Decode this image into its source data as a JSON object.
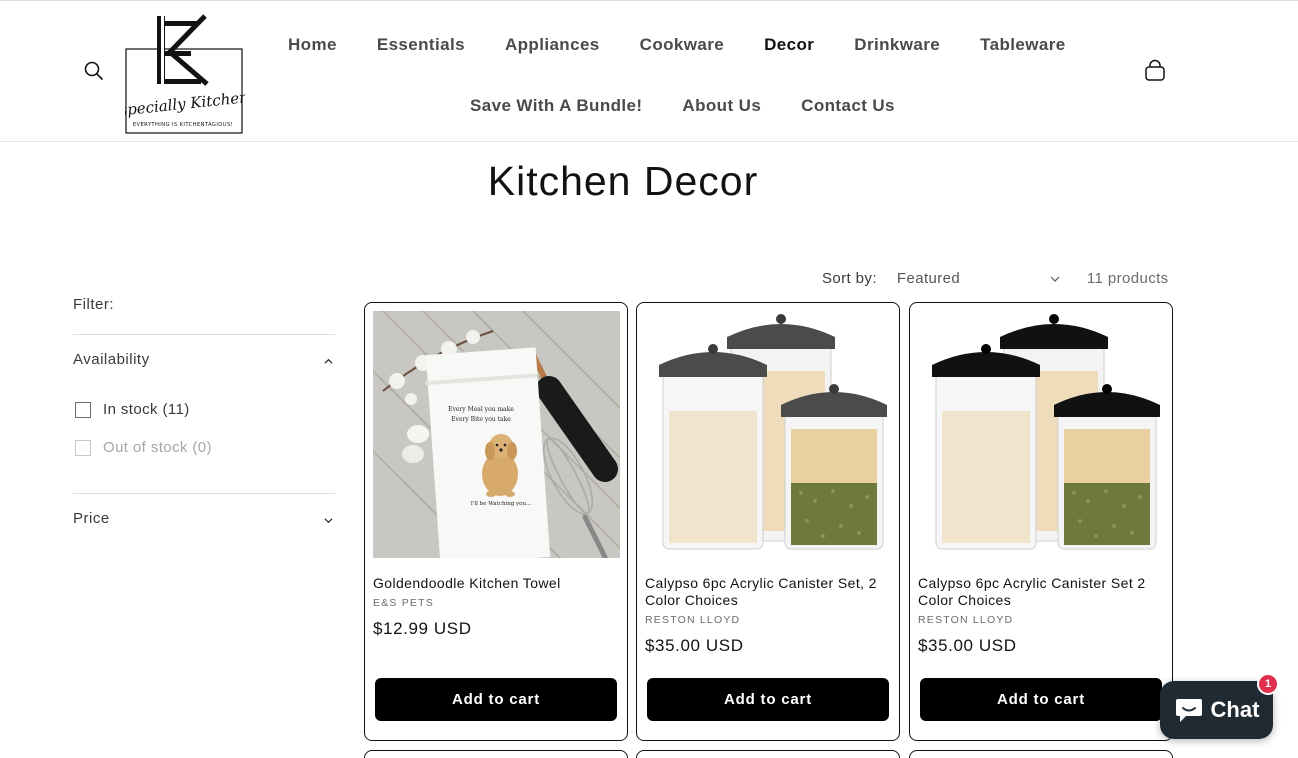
{
  "brand": {
    "logo_script": "Especially Kitchens",
    "logo_tagline": "EVERYTHING IS KITCHENTAGIOUS!"
  },
  "nav": {
    "row1": [
      {
        "label": "Home",
        "active": false
      },
      {
        "label": "Essentials",
        "active": false
      },
      {
        "label": "Appliances",
        "active": false
      },
      {
        "label": "Cookware",
        "active": false
      },
      {
        "label": "Decor",
        "active": true
      },
      {
        "label": "Drinkware",
        "active": false
      },
      {
        "label": "Tableware",
        "active": false
      }
    ],
    "row2": [
      {
        "label": "Save With A Bundle!",
        "active": false
      },
      {
        "label": "About Us",
        "active": false
      },
      {
        "label": "Contact Us",
        "active": false
      }
    ]
  },
  "header_icons": {
    "search": "search-icon",
    "cart": "cart-icon"
  },
  "collection": {
    "title": "Kitchen Decor"
  },
  "filters": {
    "heading": "Filter:",
    "availability": {
      "title": "Availability",
      "expanded": true,
      "options": [
        {
          "label": "In stock (11)",
          "disabled": false
        },
        {
          "label": "Out of stock (0)",
          "disabled": true
        }
      ]
    },
    "price": {
      "title": "Price",
      "expanded": false
    }
  },
  "sort": {
    "label": "Sort by:",
    "selected": "Featured",
    "count": "11 products"
  },
  "products": [
    {
      "title": "Goldendoodle Kitchen Towel",
      "vendor": "E&S PETS",
      "price": "$12.99 USD",
      "button": "Add to cart",
      "towel_text_1": "Every Meal you make",
      "towel_text_2": "Every Bite you take",
      "towel_text_3": "I'll be Watching you...",
      "image": "towel"
    },
    {
      "title": "Calypso 6pc Acrylic Canister Set, 2 Color Choices",
      "vendor": "RESTON LLOYD",
      "price": "$35.00 USD",
      "button": "Add to cart",
      "image": "canisters"
    },
    {
      "title": "Calypso 6pc Acrylic Canister Set 2 Color Choices",
      "vendor": "RESTON LLOYD",
      "price": "$35.00 USD",
      "button": "Add to cart",
      "image": "canisters"
    }
  ],
  "chat": {
    "label": "Chat",
    "badge": "1",
    "color": "#1f2a33",
    "badge_color": "#e0304e"
  }
}
